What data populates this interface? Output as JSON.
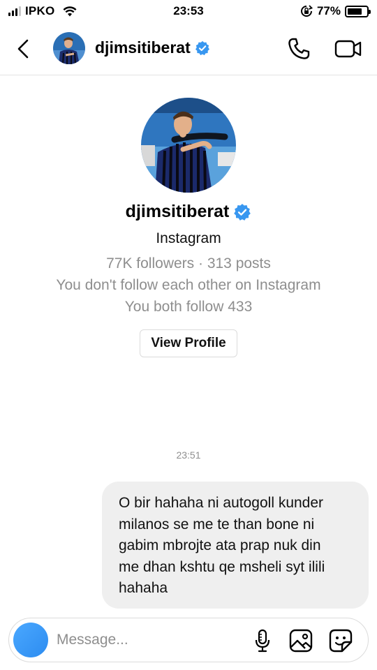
{
  "status_bar": {
    "carrier": "IPKO",
    "time": "23:53",
    "battery_percent": "77%",
    "battery_level": 0.77,
    "icons": [
      "signal-icon",
      "wifi-icon",
      "rotation-lock-icon",
      "battery-icon"
    ]
  },
  "header": {
    "username": "djimsitiberat",
    "verified": true,
    "icons": [
      "back-arrow-icon",
      "phone-icon",
      "video-camera-icon"
    ]
  },
  "profile": {
    "username": "djimsitiberat",
    "source": "Instagram",
    "stats": "77K followers · 313 posts",
    "follow_status": "You don't follow each other on Instagram",
    "mutual": "You both follow 433",
    "view_profile_label": "View Profile"
  },
  "conversation": {
    "timestamp": "23:51",
    "messages": [
      {
        "sender": "me",
        "lines": [
          "O bir hahaha ni autogoll kunder",
          "milanos se me te than bone ni",
          "gabim mbrojte ata prap nuk din",
          "me dhan kshtu qe msheli syt ilili",
          "hahaha"
        ]
      }
    ]
  },
  "composer": {
    "placeholder": "Message...",
    "icons": [
      "camera-icon",
      "microphone-icon",
      "gallery-icon",
      "sticker-icon"
    ]
  },
  "colors": {
    "accent_blue": "#3897f0",
    "bubble_gray": "#efefef",
    "secondary_text": "#8e8e8e",
    "divider": "#dbdbdb"
  }
}
